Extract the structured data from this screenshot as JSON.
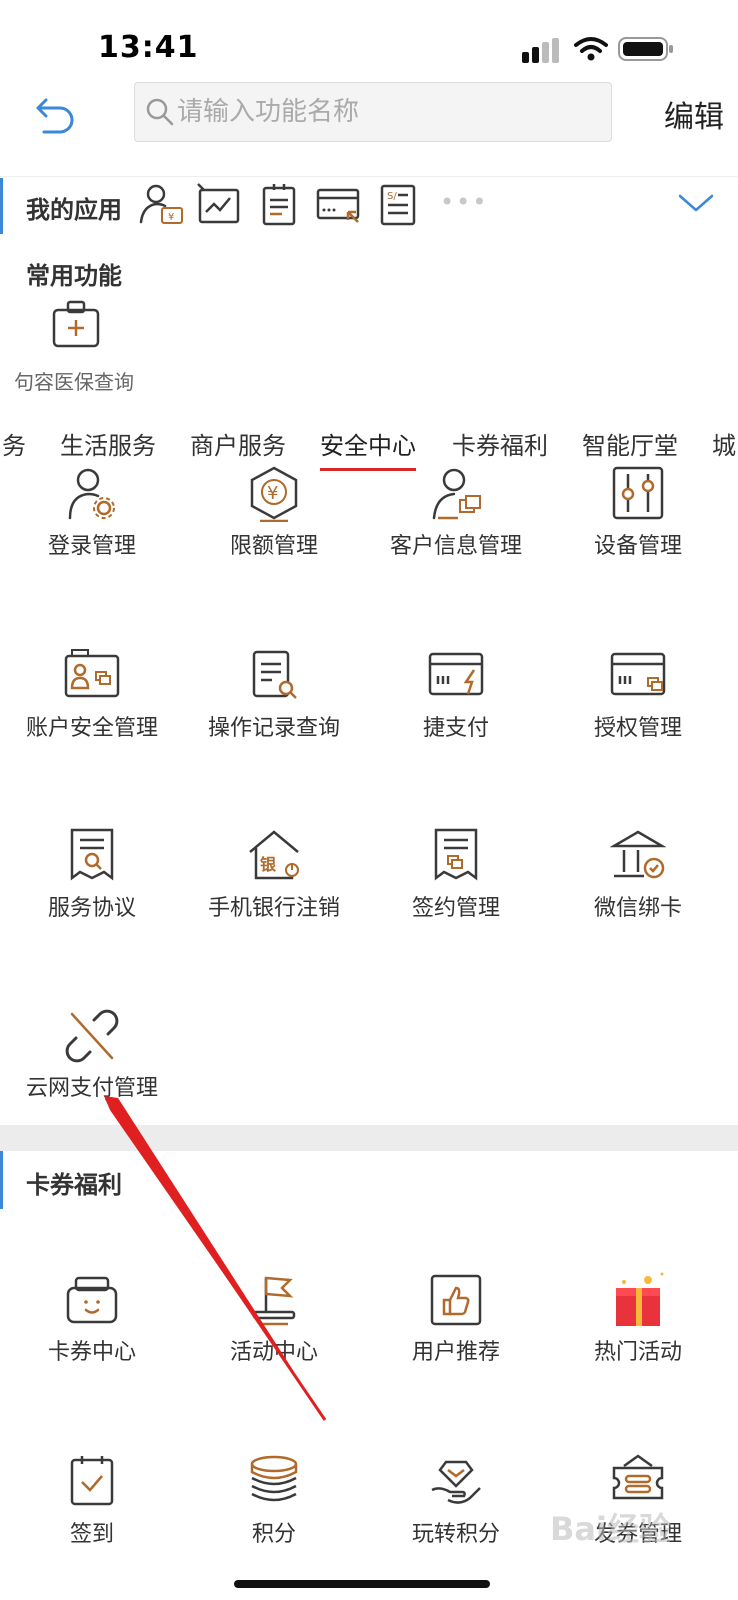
{
  "status": {
    "time": "13:41"
  },
  "header": {
    "search_placeholder": "请输入功能名称",
    "edit_label": "编辑"
  },
  "my_apps": {
    "title": "我的应用",
    "more": "•••"
  },
  "common": {
    "title": "常用功能",
    "items": [
      {
        "label": "句容医保查询"
      }
    ]
  },
  "tabs": [
    {
      "label": "务"
    },
    {
      "label": "生活服务"
    },
    {
      "label": "商户服务"
    },
    {
      "label": "安全中心",
      "active": true
    },
    {
      "label": "卡券福利"
    },
    {
      "label": "智能厅堂"
    },
    {
      "label": "城"
    }
  ],
  "security_items": [
    {
      "label": "登录管理",
      "icon": "user-gear-icon"
    },
    {
      "label": "限额管理",
      "icon": "yuan-hexagon-icon"
    },
    {
      "label": "客户信息管理",
      "icon": "user-card-icon"
    },
    {
      "label": "设备管理",
      "icon": "sliders-icon"
    },
    {
      "label": "账户安全管理",
      "icon": "account-card-icon"
    },
    {
      "label": "操作记录查询",
      "icon": "document-search-icon"
    },
    {
      "label": "捷支付",
      "icon": "card-bolt-icon"
    },
    {
      "label": "授权管理",
      "icon": "card-copy-icon"
    },
    {
      "label": "服务协议",
      "icon": "agreement-search-icon"
    },
    {
      "label": "手机银行注销",
      "icon": "bank-power-icon"
    },
    {
      "label": "签约管理",
      "icon": "agreement-copy-icon"
    },
    {
      "label": "微信绑卡",
      "icon": "bank-check-icon"
    },
    {
      "label": "云网支付管理",
      "icon": "broken-link-icon"
    }
  ],
  "coupon_section": {
    "title": "卡券福利",
    "items": [
      {
        "label": "卡券中心",
        "icon": "wallet-smile-icon"
      },
      {
        "label": "活动中心",
        "icon": "flag-icon"
      },
      {
        "label": "用户推荐",
        "icon": "thumbs-up-icon"
      },
      {
        "label": "热门活动",
        "icon": "gift-box-icon"
      },
      {
        "label": "签到",
        "icon": "calendar-check-icon"
      },
      {
        "label": "积分",
        "icon": "coin-stack-icon"
      },
      {
        "label": "玩转积分",
        "icon": "hand-diamond-icon"
      },
      {
        "label": "发券管理",
        "icon": "ticket-icon"
      }
    ]
  },
  "watermark": "Bai经验",
  "colors": {
    "accent_blue": "#3a88d6",
    "tab_red": "#d92626",
    "icon_dark": "#3a3a3a",
    "icon_orange": "#b06a2c",
    "arrow_red": "#e02020"
  }
}
